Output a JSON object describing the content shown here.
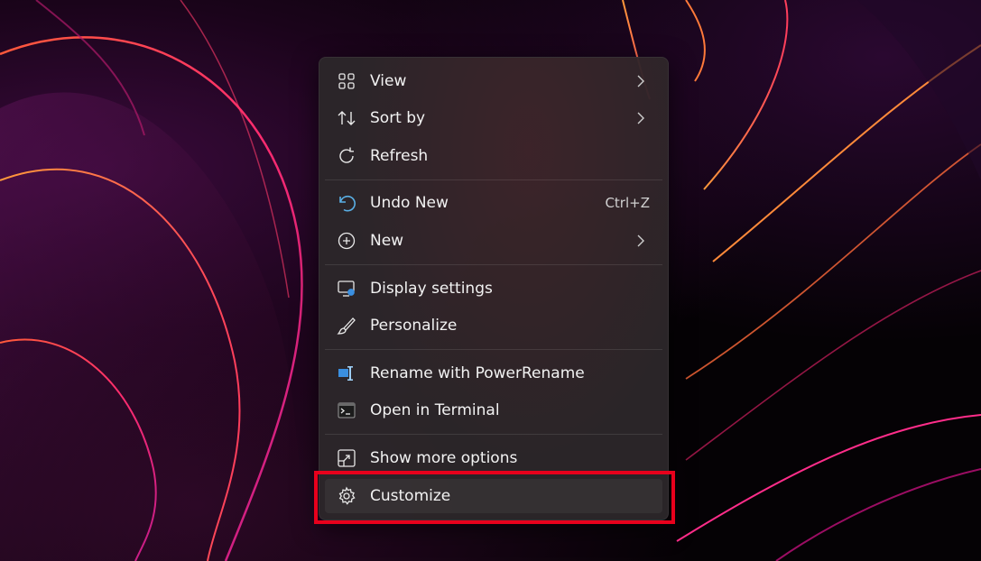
{
  "context_menu": {
    "items": [
      {
        "label": "View",
        "icon": "view-grid-icon",
        "submenu": true
      },
      {
        "label": "Sort by",
        "icon": "sort-arrows-icon",
        "submenu": true
      },
      {
        "label": "Refresh",
        "icon": "refresh-icon",
        "submenu": false
      },
      {
        "label": "Undo New",
        "icon": "undo-icon",
        "shortcut": "Ctrl+Z"
      },
      {
        "label": "New",
        "icon": "plus-circle-icon",
        "submenu": true
      },
      {
        "label": "Display settings",
        "icon": "display-settings-icon"
      },
      {
        "label": "Personalize",
        "icon": "brush-icon"
      },
      {
        "label": "Rename with PowerRename",
        "icon": "powerrename-icon"
      },
      {
        "label": "Open in Terminal",
        "icon": "terminal-icon"
      },
      {
        "label": "Show more options",
        "icon": "show-more-icon"
      },
      {
        "label": "Customize",
        "icon": "gear-icon"
      }
    ]
  },
  "colors": {
    "highlight_border": "#e8001c",
    "undo_icon": "#5ab0e6",
    "powerrename_icon": "#3a8fe0"
  }
}
